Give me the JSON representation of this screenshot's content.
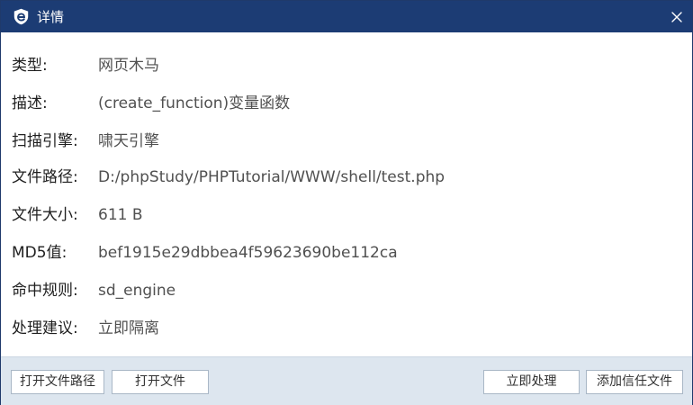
{
  "window": {
    "title": "详情"
  },
  "details": [
    {
      "label": "类型:",
      "value": "网页木马"
    },
    {
      "label": "描述:",
      "value": "(create_function)变量函数"
    },
    {
      "label": "扫描引擎:",
      "value": "啸天引擎"
    },
    {
      "label": "文件路径:",
      "value": "D:/phpStudy/PHPTutorial/WWW/shell/test.php"
    },
    {
      "label": "文件大小:",
      "value": "611 B"
    },
    {
      "label": "MD5值:",
      "value": "bef1915e29dbbea4f59623690be112ca"
    },
    {
      "label": "命中规则:",
      "value": "sd_engine"
    },
    {
      "label": "处理建议:",
      "value": "立即隔离"
    }
  ],
  "footer": {
    "open_path_label": "打开文件路径",
    "open_file_label": "打开文件",
    "handle_now_label": "立即处理",
    "add_trust_label": "添加信任文件"
  },
  "colors": {
    "titlebar": "#1c3c74",
    "footer": "#dde6ef"
  },
  "icons": {
    "app": "shield-e-icon",
    "close": "close-icon"
  }
}
